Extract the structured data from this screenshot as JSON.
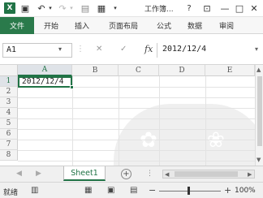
{
  "window": {
    "title": "工作簿...",
    "help": "?",
    "minimize": "—",
    "restore": "□",
    "close": "✕"
  },
  "ribbon": {
    "file_tab": "文件",
    "tabs": [
      "开始",
      "插入",
      "页面布局",
      "公式",
      "数据",
      "审阅"
    ]
  },
  "formula_bar": {
    "name_box": "A1",
    "fx_label": "fx",
    "formula": "2012/12/4"
  },
  "grid": {
    "columns": [
      "A",
      "B",
      "C",
      "D",
      "E"
    ],
    "rows": [
      "1",
      "2",
      "3",
      "4",
      "5",
      "6",
      "7",
      "8"
    ],
    "active_cell_value": "2012/12/4"
  },
  "sheets": {
    "tabs": [
      "Sheet1"
    ],
    "active": "Sheet1",
    "add_label": "+"
  },
  "status_bar": {
    "mode": "就绪",
    "zoom": "100%"
  },
  "colors": {
    "accent": "#217346",
    "file_tab": "#2a7a4b"
  }
}
